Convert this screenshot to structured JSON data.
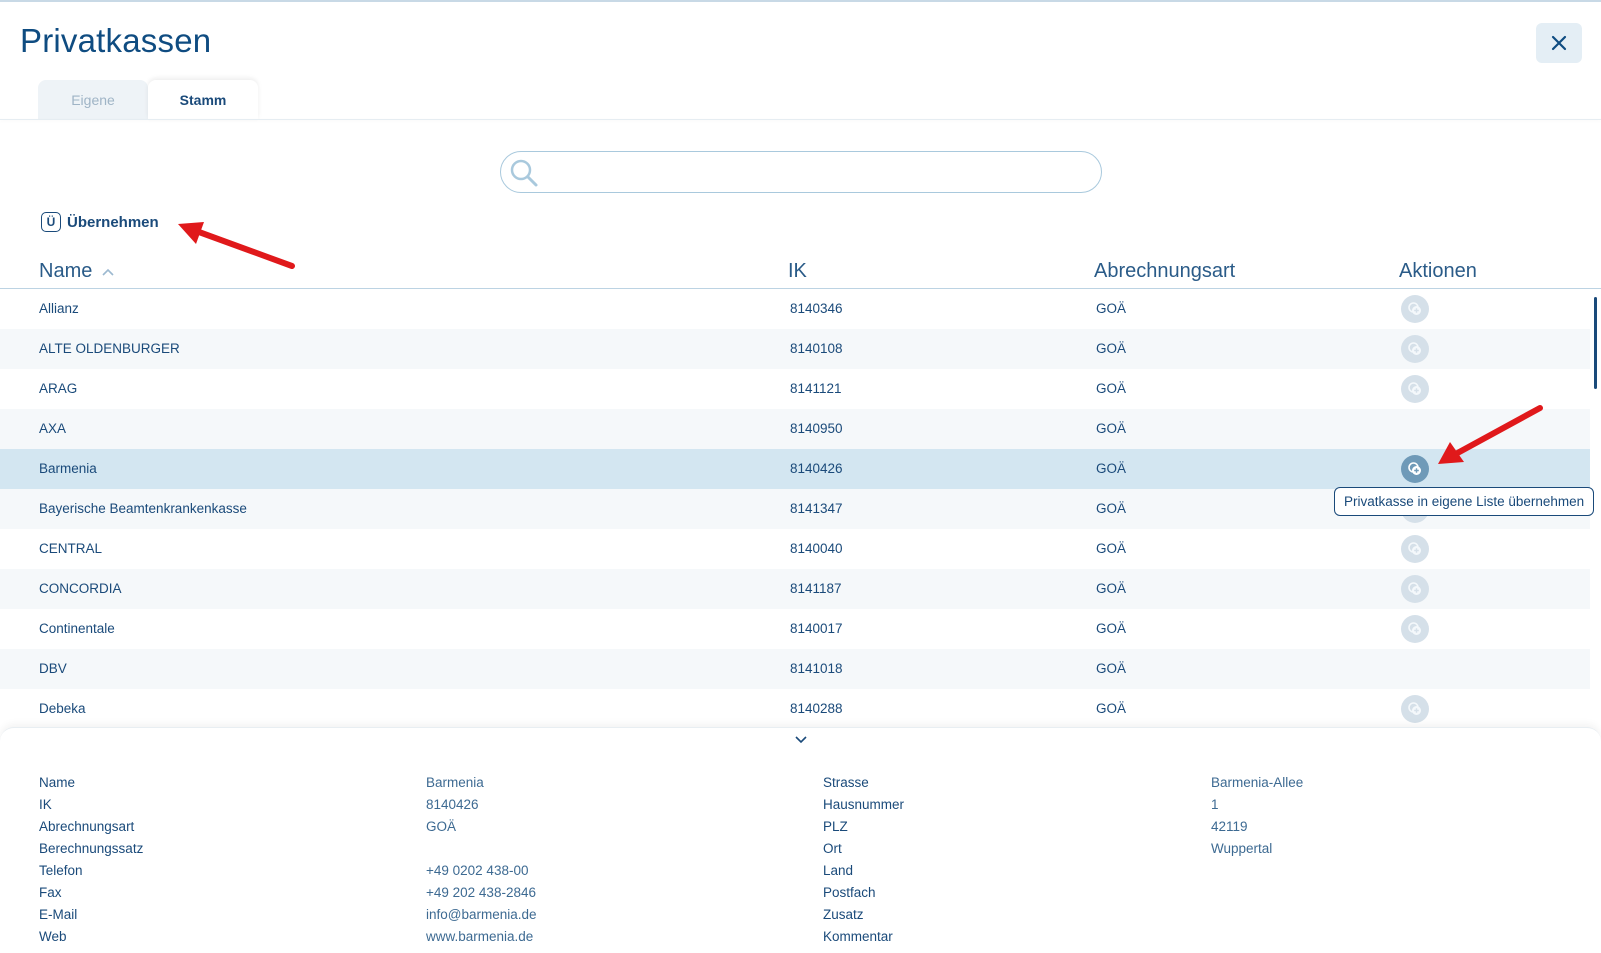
{
  "title": "Privatkassen",
  "close_icon": "close-icon",
  "tabs": [
    {
      "label": "Eigene",
      "active": false
    },
    {
      "label": "Stamm",
      "active": true
    }
  ],
  "search": {
    "value": "",
    "placeholder": ""
  },
  "uebernehmen": {
    "icon": "Ü",
    "label": "Übernehmen"
  },
  "table": {
    "columns": {
      "name": "Name",
      "ik": "IK",
      "art": "Abrechnungsart",
      "actions": "Aktionen"
    },
    "rows": [
      {
        "name": "Allianz",
        "ik": "8140346",
        "art": "GOÄ",
        "action": true
      },
      {
        "name": "ALTE OLDENBURGER",
        "ik": "8140108",
        "art": "GOÄ",
        "action": true
      },
      {
        "name": "ARAG",
        "ik": "8141121",
        "art": "GOÄ",
        "action": true
      },
      {
        "name": "AXA",
        "ik": "8140950",
        "art": "GOÄ",
        "action": false
      },
      {
        "name": "Barmenia",
        "ik": "8140426",
        "art": "GOÄ",
        "action": true,
        "selected": true
      },
      {
        "name": "Bayerische Beamtenkrankenkasse",
        "ik": "8141347",
        "art": "GOÄ",
        "action": true
      },
      {
        "name": "CENTRAL",
        "ik": "8140040",
        "art": "GOÄ",
        "action": true
      },
      {
        "name": "CONCORDIA",
        "ik": "8141187",
        "art": "GOÄ",
        "action": true
      },
      {
        "name": "Continentale",
        "ik": "8140017",
        "art": "GOÄ",
        "action": true
      },
      {
        "name": "DBV",
        "ik": "8141018",
        "art": "GOÄ",
        "action": false
      },
      {
        "name": "Debeka",
        "ik": "8140288",
        "art": "GOÄ",
        "action": true
      }
    ]
  },
  "tooltip": "Privatkasse in eigene Liste übernehmen",
  "detail": {
    "left": [
      {
        "label": "Name",
        "value": "Barmenia"
      },
      {
        "label": "IK",
        "value": "8140426"
      },
      {
        "label": "Abrechnungsart",
        "value": "GOÄ"
      },
      {
        "label": "Berechnungssatz",
        "value": ""
      },
      {
        "label": "Telefon",
        "value": "+49 0202 438-00"
      },
      {
        "label": "Fax",
        "value": "+49 202 438-2846"
      },
      {
        "label": "E-Mail",
        "value": "info@barmenia.de"
      },
      {
        "label": "Web",
        "value": "www.barmenia.de"
      }
    ],
    "right": [
      {
        "label": "Strasse",
        "value": "Barmenia-Allee"
      },
      {
        "label": "Hausnummer",
        "value": "1"
      },
      {
        "label": "PLZ",
        "value": "42119"
      },
      {
        "label": "Ort",
        "value": "Wuppertal"
      },
      {
        "label": "Land",
        "value": ""
      },
      {
        "label": "Postfach",
        "value": ""
      },
      {
        "label": "Zusatz",
        "value": ""
      },
      {
        "label": "Kommentar",
        "value": ""
      }
    ]
  },
  "colors": {
    "accent": "#0f4c81",
    "selected_row": "#d3e6f1",
    "arrow": "#e0191b"
  }
}
